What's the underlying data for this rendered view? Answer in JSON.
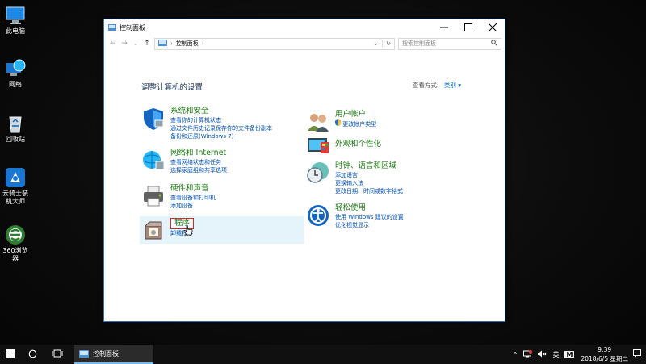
{
  "desktop": {
    "icons": [
      {
        "label": "此电脑"
      },
      {
        "label": "网络"
      },
      {
        "label": "回收站"
      },
      {
        "label": "云骑士装机大师"
      },
      {
        "label": "360浏览器"
      }
    ]
  },
  "window": {
    "title": "控制面板",
    "address": {
      "root_sep": "›",
      "crumb": "控制面板",
      "trail_sep": "›"
    },
    "search_placeholder": "搜索控制面板",
    "heading": "调整计算机的设置",
    "view_by": {
      "label": "查看方式:",
      "value": "类别"
    },
    "categories_left": [
      {
        "title": "系统和安全",
        "links": [
          "查看你的计算机状态",
          "通过文件历史记录保存你的文件备份副本",
          "备份和还原(Windows 7)"
        ]
      },
      {
        "title": "网络和 Internet",
        "links": [
          "查看网络状态和任务",
          "选择家庭组和共享选项"
        ]
      },
      {
        "title": "硬件和声音",
        "links": [
          "查看设备和打印机",
          "添加设备"
        ]
      },
      {
        "title": "程序",
        "links": [
          "卸载程序"
        ]
      }
    ],
    "categories_right": [
      {
        "title": "用户帐户",
        "links": [
          "更改帐户类型"
        ]
      },
      {
        "title": "外观和个性化",
        "links": []
      },
      {
        "title": "时钟、语言和区域",
        "links": [
          "添加语言",
          "更换输入法",
          "更改日期、时间或数字格式"
        ]
      },
      {
        "title": "轻松使用",
        "links": [
          "使用 Windows 建议的设置",
          "优化视觉显示"
        ]
      }
    ]
  },
  "taskbar": {
    "app_label": "控制面板",
    "tray": {
      "lang": "英",
      "ime": "M"
    },
    "clock": {
      "time": "9:39",
      "date": "2018/6/5 星期二"
    }
  },
  "colors": {
    "accent": "#0078d7",
    "link": "#0050b3",
    "category_title": "#1e7b14"
  }
}
